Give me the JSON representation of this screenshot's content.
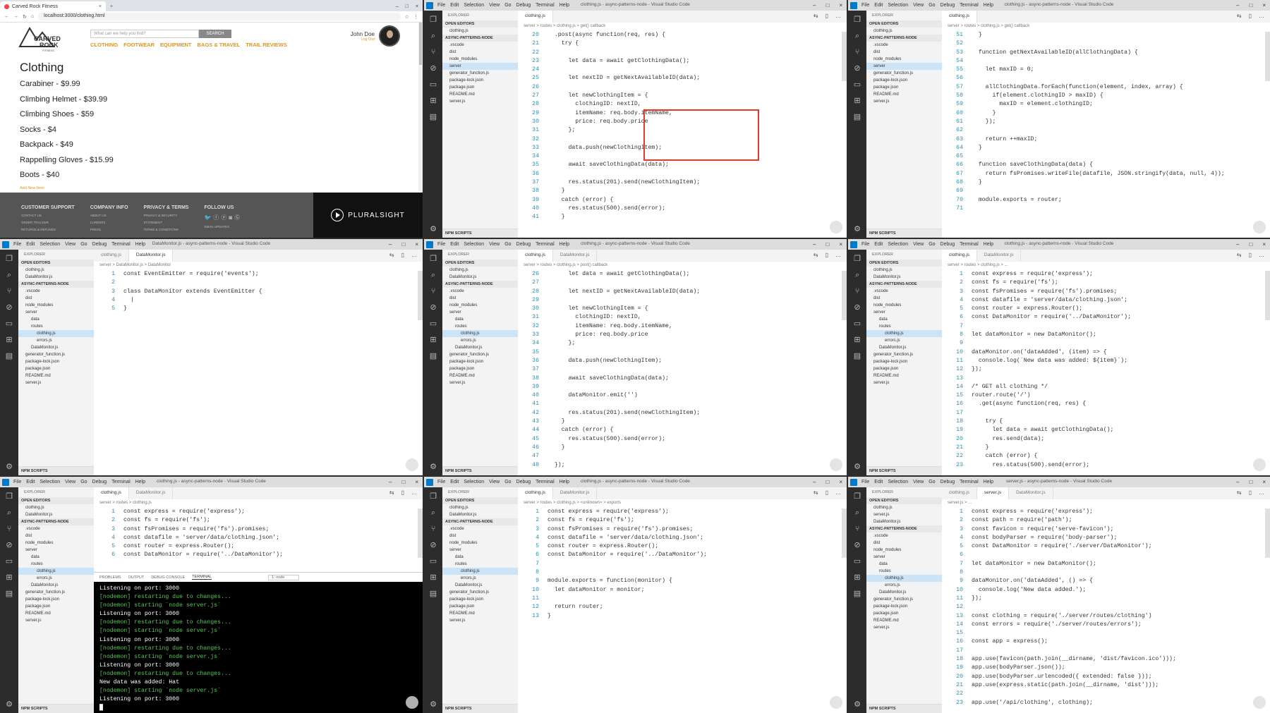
{
  "browser": {
    "tab_title": "Carved Rock Fitness",
    "url": "localhost:3000/clothing.html",
    "search_placeholder": "What can we help you find?",
    "search_button": "SEARCH",
    "nav": [
      "CLOTHING",
      "FOOTWEAR",
      "EQUIPMENT",
      "BAGS & TRAVEL",
      "TRAIL REVIEWS"
    ],
    "user_name": "John Doe",
    "logout": "Log Out",
    "heading": "Clothing",
    "items": [
      "Carabiner - $9.99",
      "Climbing Helmet - $39.99",
      "Climbing Shoes - $59",
      "Socks - $4",
      "Backpack - $49",
      "Rappelling Gloves - $15.99",
      "Boots - $40"
    ],
    "add_link": "Add New Item",
    "footer": [
      {
        "title": "CUSTOMER SUPPORT",
        "links": [
          "CONTACT US",
          "ORDER TRACKER",
          "RETURNS & REFUNDS"
        ]
      },
      {
        "title": "COMPANY INFO",
        "links": [
          "ABOUT US",
          "CAREERS",
          "PRESS"
        ]
      },
      {
        "title": "PRIVACY & TERMS",
        "links": [
          "PRIVACY & SECURITY",
          "STATEMENT",
          "TERMS & CONDITIONS"
        ]
      },
      {
        "title": "FOLLOW US",
        "links": [
          "EMAIL UPDATES"
        ]
      }
    ],
    "brand": "PLURALSIGHT"
  },
  "vscode": {
    "menu": [
      "File",
      "Edit",
      "Selection",
      "View",
      "Go",
      "Debug",
      "Terminal",
      "Help"
    ],
    "window_title_clothing": "clothing.js - async-patterns-node - Visual Studio Code",
    "window_title_monitor": "DataMonitor.js - async-patterns-node - Visual Studio Code",
    "window_title_server": "server.js - async-patterns-node - Visual Studio Code",
    "explorer": "EXPLORER",
    "open_editors": "OPEN EDITORS",
    "project": "ASYNC-PATTERNS-NODE",
    "npm": "NPM SCRIPTS",
    "tab_clothing": "clothing.js",
    "tab_monitor": "DataMonitor.js",
    "tab_server": "server.js"
  },
  "p2": {
    "crumb": "server > routes > clothing.js > get() callback",
    "lines": [
      [
        "20",
        "  .post(async function(req, res) {"
      ],
      [
        "21",
        "    try {"
      ],
      [
        "22",
        ""
      ],
      [
        "23",
        "      let data = await getClothingData();"
      ],
      [
        "24",
        ""
      ],
      [
        "25",
        "      let nextID = getNextAvailableID(data);"
      ],
      [
        "26",
        ""
      ],
      [
        "27",
        "      let newClothingItem = {"
      ],
      [
        "28",
        "        clothingID: nextID,"
      ],
      [
        "29",
        "        itemName: req.body.itemName,"
      ],
      [
        "30",
        "        price: req.body.price"
      ],
      [
        "31",
        "      };"
      ],
      [
        "32",
        ""
      ],
      [
        "33",
        "      data.push(newClothingItem);"
      ],
      [
        "34",
        ""
      ],
      [
        "35",
        "      await saveClothingData(data);"
      ],
      [
        "36",
        ""
      ],
      [
        "37",
        "      res.status(201).send(newClothingItem);"
      ],
      [
        "38",
        "    }"
      ],
      [
        "39",
        "    catch (error) {"
      ],
      [
        "40",
        "      res.status(500).send(error);"
      ],
      [
        "41",
        "    }"
      ]
    ]
  },
  "p3": {
    "crumb": "server > routes > clothing.js > get() callback",
    "lines": [
      [
        "51",
        "  }"
      ],
      [
        "52",
        ""
      ],
      [
        "53",
        "  function getNextAvailableID(allClothingData) {"
      ],
      [
        "54",
        ""
      ],
      [
        "55",
        "    let maxID = 0;"
      ],
      [
        "56",
        ""
      ],
      [
        "57",
        "    allClothingData.forEach(function(element, index, array) {"
      ],
      [
        "58",
        "      if(element.clothingID > maxID) {"
      ],
      [
        "59",
        "        maxID = element.clothingID;"
      ],
      [
        "60",
        "      }"
      ],
      [
        "61",
        "    });"
      ],
      [
        "62",
        ""
      ],
      [
        "63",
        "    return ++maxID;"
      ],
      [
        "64",
        "  }"
      ],
      [
        "65",
        ""
      ],
      [
        "66",
        "  function saveClothingData(data) {"
      ],
      [
        "67",
        "    return fsPromises.writeFile(datafile, JSON.stringify(data, null, 4));"
      ],
      [
        "68",
        "  }"
      ],
      [
        "69",
        ""
      ],
      [
        "70",
        "  module.exports = router;"
      ],
      [
        "71",
        ""
      ]
    ]
  },
  "p4": {
    "crumb": "server > DataMonitor.js > DataMonitor",
    "lines": [
      [
        "1",
        "const EventEmitter = require('events');"
      ],
      [
        "2",
        ""
      ],
      [
        "3",
        "class DataMonitor extends EventEmitter {"
      ],
      [
        "4",
        "  |"
      ],
      [
        "5",
        "}"
      ]
    ]
  },
  "p5": {
    "crumb": "server > routes > clothing.js > post() callback",
    "lines": [
      [
        "26",
        "      let data = await getClothingData();"
      ],
      [
        "27",
        ""
      ],
      [
        "28",
        "      let nextID = getNextAvailableID(data);"
      ],
      [
        "29",
        ""
      ],
      [
        "30",
        "      let newClothingItem = {"
      ],
      [
        "31",
        "        clothingID: nextID,"
      ],
      [
        "32",
        "        itemName: req.body.itemName,"
      ],
      [
        "33",
        "        price: req.body.price"
      ],
      [
        "34",
        "      };"
      ],
      [
        "35",
        ""
      ],
      [
        "36",
        "      data.push(newClothingItem);"
      ],
      [
        "37",
        ""
      ],
      [
        "38",
        "      await saveClothingData(data);"
      ],
      [
        "39",
        ""
      ],
      [
        "40",
        "      dataMonitor.emit('')"
      ],
      [
        "41",
        ""
      ],
      [
        "42",
        "      res.status(201).send(newClothingItem);"
      ],
      [
        "43",
        "    }"
      ],
      [
        "44",
        "    catch (error) {"
      ],
      [
        "45",
        "      res.status(500).send(error);"
      ],
      [
        "46",
        "    }"
      ],
      [
        "47",
        ""
      ],
      [
        "48",
        "  });"
      ]
    ]
  },
  "p6": {
    "crumb": "server > routes > clothing.js > ...",
    "lines": [
      [
        "1",
        "const express = require('express');"
      ],
      [
        "2",
        "const fs = require('fs');"
      ],
      [
        "3",
        "const fsPromises = require('fs').promises;"
      ],
      [
        "4",
        "const datafile = 'server/data/clothing.json';"
      ],
      [
        "5",
        "const router = express.Router();"
      ],
      [
        "6",
        "const DataMonitor = require('../DataMonitor');"
      ],
      [
        "7",
        ""
      ],
      [
        "8",
        "let dataMonitor = new DataMonitor();"
      ],
      [
        "9",
        ""
      ],
      [
        "10",
        "dataMonitor.on('dataAdded', (item) => {"
      ],
      [
        "11",
        "  console.log(`New data was added: ${item}`);"
      ],
      [
        "12",
        "});"
      ],
      [
        "13",
        ""
      ],
      [
        "14",
        "/* GET all clothing */"
      ],
      [
        "15",
        "router.route('/')"
      ],
      [
        "16",
        "  .get(async function(req, res) {"
      ],
      [
        "17",
        ""
      ],
      [
        "18",
        "    try {"
      ],
      [
        "19",
        "      let data = await getClothingData();"
      ],
      [
        "20",
        "      res.send(data);"
      ],
      [
        "21",
        "    }"
      ],
      [
        "22",
        "    catch (error) {"
      ],
      [
        "23",
        "      res.status(500).send(error);"
      ]
    ]
  },
  "p7": {
    "crumb": "server > routes > clothing.js",
    "lines": [
      [
        "1",
        "const express = require('express');"
      ],
      [
        "2",
        "const fs = require('fs');"
      ],
      [
        "3",
        "const fsPromises = require('fs').promises;"
      ],
      [
        "4",
        "const datafile = 'server/data/clothing.json';"
      ],
      [
        "5",
        "const router = express.Router();"
      ],
      [
        "6",
        "const DataMonitor = require('../DataMonitor');"
      ]
    ],
    "term_tabs": [
      "PROBLEMS",
      "OUTPUT",
      "DEBUG CONSOLE",
      "TERMINAL"
    ],
    "term_select": "1: node",
    "term": [
      [
        "w",
        "Listening on port: 3000"
      ],
      [
        "g",
        "[nodemon] restarting due to changes..."
      ],
      [
        "g",
        "[nodemon] starting `node server.js`"
      ],
      [
        "w",
        "Listening on port: 3000"
      ],
      [
        "g",
        "[nodemon] restarting due to changes..."
      ],
      [
        "g",
        "[nodemon] starting `node server.js`"
      ],
      [
        "w",
        "Listening on port: 3000"
      ],
      [
        "g",
        "[nodemon] restarting due to changes..."
      ],
      [
        "g",
        "[nodemon] starting `node server.js`"
      ],
      [
        "w",
        "Listening on port: 3000"
      ],
      [
        "g",
        "[nodemon] restarting due to changes..."
      ],
      [
        "w",
        "New data was added: Hat"
      ],
      [
        "g",
        "[nodemon] starting `node server.js`"
      ],
      [
        "w",
        "Listening on port: 3000"
      ]
    ]
  },
  "p8": {
    "crumb": "server > routes > clothing.js > <unknown> > exports",
    "lines": [
      [
        "1",
        "const express = require('express');"
      ],
      [
        "2",
        "const fs = require('fs');"
      ],
      [
        "3",
        "const fsPromises = require('fs').promises;"
      ],
      [
        "4",
        "const datafile = 'server/data/clothing.json';"
      ],
      [
        "5",
        "const router = express.Router();"
      ],
      [
        "6",
        "const DataMonitor = require('../DataMonitor');"
      ],
      [
        "7",
        ""
      ],
      [
        "8",
        ""
      ],
      [
        "9",
        "module.exports = function(monitor) {"
      ],
      [
        "10",
        "  let dataMonitor = monitor;"
      ],
      [
        "11",
        ""
      ],
      [
        "12",
        "  return router;"
      ],
      [
        "13",
        "}"
      ]
    ]
  },
  "p9": {
    "crumb": "server.js > ...",
    "lines": [
      [
        "1",
        "const express = require('express');"
      ],
      [
        "2",
        "const path = require('path');"
      ],
      [
        "3",
        "const favicon = require('serve-favicon');"
      ],
      [
        "4",
        "const bodyParser = require('body-parser');"
      ],
      [
        "5",
        "const DataMonitor = require('./server/DataMonitor');"
      ],
      [
        "6",
        ""
      ],
      [
        "7",
        "let dataMonitor = new DataMonitor();"
      ],
      [
        "8",
        ""
      ],
      [
        "9",
        "dataMonitor.on('dataAdded', () => {"
      ],
      [
        "10",
        "  console.log('New data added.');"
      ],
      [
        "11",
        "});"
      ],
      [
        "12",
        ""
      ],
      [
        "13",
        "const clothing = require('./server/routes/clothing')"
      ],
      [
        "14",
        "const errors = require('./server/routes/errors');"
      ],
      [
        "15",
        ""
      ],
      [
        "16",
        "const app = express();"
      ],
      [
        "17",
        ""
      ],
      [
        "18",
        "app.use(favicon(path.join(__dirname, 'dist/favicon.ico')));"
      ],
      [
        "19",
        "app.use(bodyParser.json());"
      ],
      [
        "20",
        "app.use(bodyParser.urlencoded({ extended: false }));"
      ],
      [
        "21",
        "app.use(express.static(path.join(__dirname, 'dist')));"
      ],
      [
        "22",
        ""
      ],
      [
        "23",
        "app.use('/api/clothing', clothing);"
      ]
    ]
  },
  "side_tree_a": [
    "clothing.js",
    "DataMonitor.js",
    ".vscode",
    "dist",
    "node_modules",
    "server",
    "data",
    "routes",
    "clothing.js",
    "errors.js",
    "DataMonitor.js",
    "generator_function.js",
    "package-lock.json",
    "package.json",
    "README.md",
    "server.js"
  ],
  "side_tree_b": [
    "clothing.js",
    ".vscode",
    "dist",
    "node_modules",
    "server",
    "generator_function.js",
    "package-lock.json",
    "package.json",
    "README.md",
    "server.js"
  ]
}
